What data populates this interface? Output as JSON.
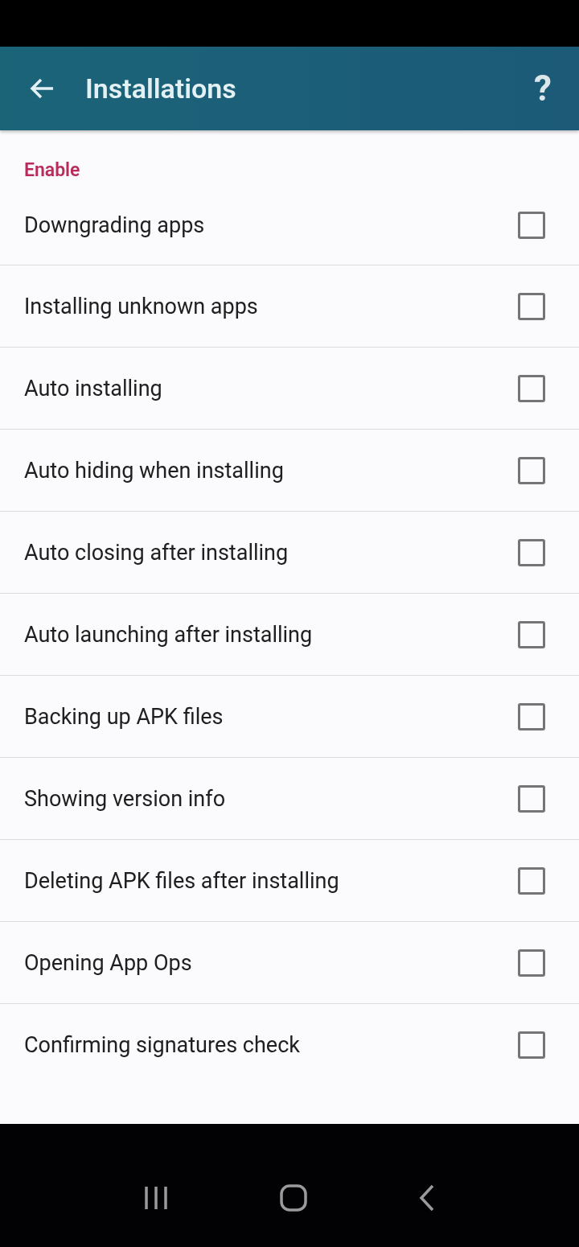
{
  "app_bar": {
    "title": "Installations",
    "help": "?"
  },
  "section": {
    "title": "Enable"
  },
  "options": [
    {
      "label": "Downgrading apps",
      "checked": false
    },
    {
      "label": "Installing unknown apps",
      "checked": false
    },
    {
      "label": "Auto installing",
      "checked": false
    },
    {
      "label": "Auto hiding when installing",
      "checked": false
    },
    {
      "label": "Auto closing after installing",
      "checked": false
    },
    {
      "label": "Auto launching after installing",
      "checked": false
    },
    {
      "label": "Backing up APK files",
      "checked": false
    },
    {
      "label": "Showing version info",
      "checked": false
    },
    {
      "label": "Deleting APK files after installing",
      "checked": false
    },
    {
      "label": "Opening App Ops",
      "checked": false
    },
    {
      "label": "Confirming signatures check",
      "checked": false
    }
  ]
}
